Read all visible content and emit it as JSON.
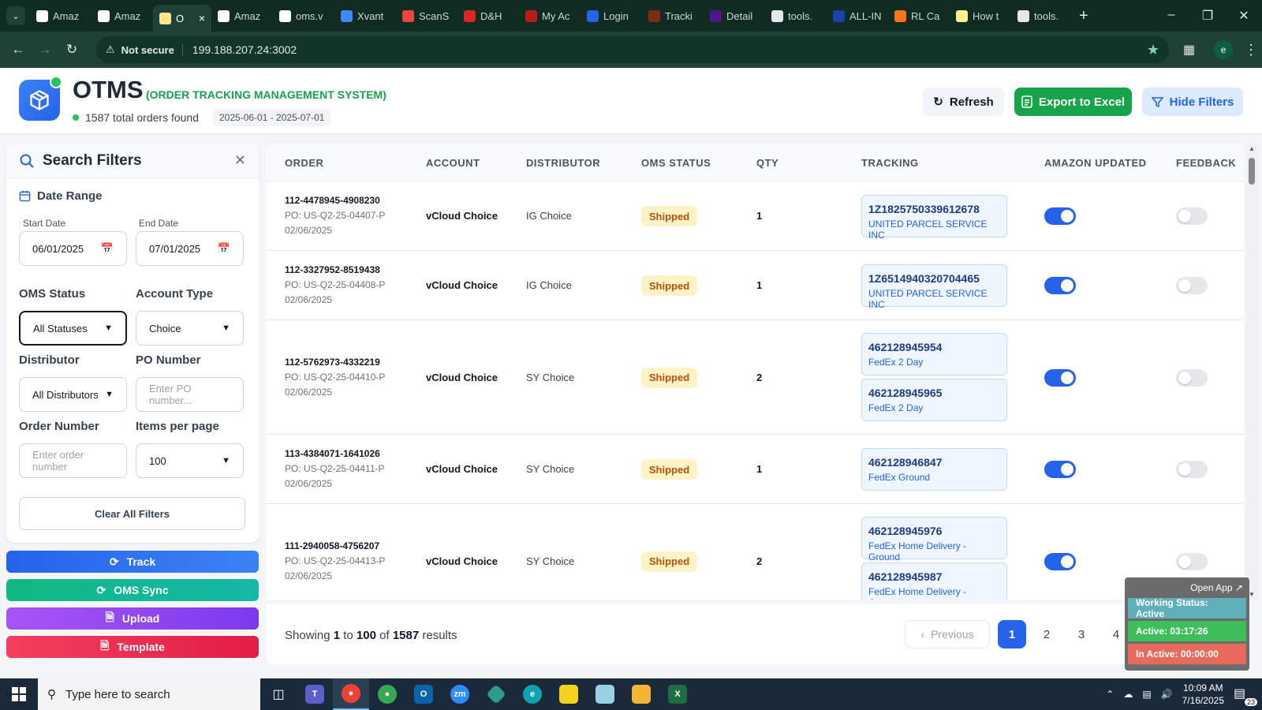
{
  "browser": {
    "tabs": [
      {
        "label": "Amaz",
        "icon": "amazon-icon"
      },
      {
        "label": "Amaz",
        "icon": "amazon-icon"
      },
      {
        "label": "O",
        "icon": "otms-icon",
        "active": true
      },
      {
        "label": "Amaz",
        "icon": "amazon-icon"
      },
      {
        "label": "oms.v",
        "icon": "oms-icon"
      },
      {
        "label": "Xvant",
        "icon": "xvant-icon"
      },
      {
        "label": "ScanS",
        "icon": "scan-icon"
      },
      {
        "label": "D&H",
        "icon": "dh-icon"
      },
      {
        "label": "My Ac",
        "icon": "account-icon"
      },
      {
        "label": "Login",
        "icon": "login-icon"
      },
      {
        "label": "Tracki",
        "icon": "ups-icon"
      },
      {
        "label": "Detail",
        "icon": "fedex-icon"
      },
      {
        "label": "tools.",
        "icon": "tools-icon"
      },
      {
        "label": "ALL-IN",
        "icon": "allin-icon"
      },
      {
        "label": "RL Ca",
        "icon": "rl-icon"
      },
      {
        "label": "How t",
        "icon": "how-icon"
      },
      {
        "label": "tools.",
        "icon": "tools-icon"
      }
    ],
    "security_label": "Not secure",
    "url": "199.188.207.24:3002",
    "profile_initial": "e"
  },
  "header": {
    "title": "OTMS",
    "subtitle": "(ORDER TRACKING MANAGEMENT SYSTEM)",
    "order_count": "1587 total orders found",
    "date_range": "2025-06-01 - 2025-07-01",
    "refresh_label": "Refresh",
    "export_label": "Export to Excel",
    "hide_filters_label": "Hide Filters",
    "accent_green": "#16a34a",
    "accent_blue": "#2563eb"
  },
  "filters": {
    "title": "Search Filters",
    "date_range_title": "Date Range",
    "start_date_label": "Start Date",
    "start_date_value": "06/01/2025",
    "end_date_label": "End Date",
    "end_date_value": "07/01/2025",
    "oms_status_label": "OMS Status",
    "oms_status_value": "All Statuses",
    "account_type_label": "Account Type",
    "account_type_value": "Choice",
    "distributor_label": "Distributor",
    "distributor_value": "All Distributors",
    "po_number_label": "PO Number",
    "po_number_placeholder": "Enter PO number...",
    "order_number_label": "Order Number",
    "order_number_placeholder": "Enter order number",
    "items_per_page_label": "Items per page",
    "items_per_page_value": "100",
    "clear_label": "Clear All Filters"
  },
  "actions": {
    "track": "Track",
    "oms_sync": "OMS Sync",
    "upload": "Upload",
    "template": "Template"
  },
  "table": {
    "columns": [
      "ORDER",
      "ACCOUNT",
      "DISTRIBUTOR",
      "OMS STATUS",
      "QTY",
      "TRACKING",
      "AMAZON UPDATED",
      "FEEDBACK"
    ],
    "rows": [
      {
        "order": "112-4478945-4908230",
        "po": "PO: US-Q2-25-04407-P",
        "date": "02/06/2025",
        "account": "vCloud Choice",
        "distributor": "IG Choice",
        "status": "Shipped",
        "qty": "1",
        "tracking": [
          {
            "number": "1Z1825750339612678",
            "carrier": "UNITED PARCEL SERVICE INC"
          }
        ],
        "amazon_updated": true,
        "feedback": false
      },
      {
        "order": "112-3327952-8519438",
        "po": "PO: US-Q2-25-04408-P",
        "date": "02/06/2025",
        "account": "vCloud Choice",
        "distributor": "IG Choice",
        "status": "Shipped",
        "qty": "1",
        "tracking": [
          {
            "number": "1Z6514940320704465",
            "carrier": "UNITED PARCEL SERVICE INC"
          }
        ],
        "amazon_updated": true,
        "feedback": false
      },
      {
        "order": "112-5762973-4332219",
        "po": "PO: US-Q2-25-04410-P",
        "date": "02/06/2025",
        "account": "vCloud Choice",
        "distributor": "SY Choice",
        "status": "Shipped",
        "qty": "2",
        "tracking": [
          {
            "number": "462128945954",
            "carrier": "FedEx 2 Day"
          },
          {
            "number": "462128945965",
            "carrier": "FedEx 2 Day"
          }
        ],
        "amazon_updated": true,
        "feedback": false
      },
      {
        "order": "113-4384071-1641026",
        "po": "PO: US-Q2-25-04411-P",
        "date": "02/06/2025",
        "account": "vCloud Choice",
        "distributor": "SY Choice",
        "status": "Shipped",
        "qty": "1",
        "tracking": [
          {
            "number": "462128946847",
            "carrier": "FedEx Ground"
          }
        ],
        "amazon_updated": true,
        "feedback": false
      },
      {
        "order": "111-2940058-4756207",
        "po": "PO: US-Q2-25-04413-P",
        "date": "02/06/2025",
        "account": "vCloud Choice",
        "distributor": "SY Choice",
        "status": "Shipped",
        "qty": "2",
        "tracking": [
          {
            "number": "462128945976",
            "carrier": "FedEx Home Delivery - Ground"
          },
          {
            "number": "462128945987",
            "carrier": "FedEx Home Delivery - Ground"
          }
        ],
        "amazon_updated": true,
        "feedback": false
      }
    ]
  },
  "pagination": {
    "showing_prefix": "Showing",
    "from": "1",
    "to_word": "to",
    "to": "100",
    "of_word": "of",
    "total": "1587",
    "results_word": "results",
    "previous_label": "Previous",
    "pages": [
      "1",
      "2",
      "3",
      "4"
    ],
    "current_page": "1"
  },
  "status_widget": {
    "open_app": "Open App ↗",
    "working_status": "Working Status: Active",
    "active_time": "Active: 03:17:26",
    "inactive_time": "In Active: 00:00:00"
  },
  "taskbar": {
    "search_placeholder": "Type here to search",
    "time": "10:09 AM",
    "date": "7/16/2025",
    "notification_count": "23"
  }
}
